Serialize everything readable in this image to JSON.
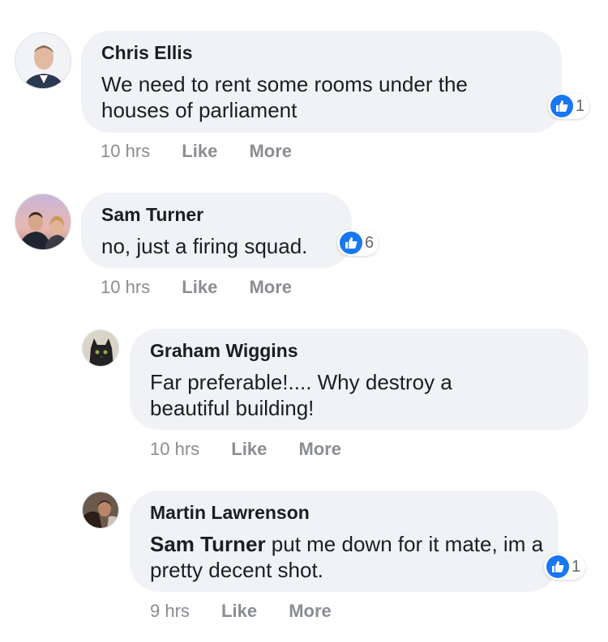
{
  "colors": {
    "like_blue": "#1877f2",
    "bubble_bg": "#f0f2f5",
    "meta_gray": "#8a8d91"
  },
  "comments": [
    {
      "author": "Chris Ellis",
      "text": "We need to rent some rooms under the houses of parliament",
      "reaction_icon": "thumbs-up-icon",
      "reaction_count": "1",
      "time": "10 hrs",
      "like_label": "Like",
      "more_label": "More"
    },
    {
      "author": "Sam Turner",
      "text": "no, just a firing squad.",
      "reaction_icon": "thumbs-up-icon",
      "reaction_count": "6",
      "time": "10 hrs",
      "like_label": "Like",
      "more_label": "More"
    },
    {
      "author": "Graham Wiggins",
      "text": "Far preferable!.... Why destroy a beautiful building!",
      "time": "10 hrs",
      "like_label": "Like",
      "more_label": "More"
    },
    {
      "author": "Martin Lawrenson",
      "mention": "Sam Turner",
      "text": " put me down for it mate, im a pretty decent shot.",
      "reaction_icon": "thumbs-up-icon",
      "reaction_count": "1",
      "time": "9 hrs",
      "like_label": "Like",
      "more_label": "More"
    }
  ]
}
